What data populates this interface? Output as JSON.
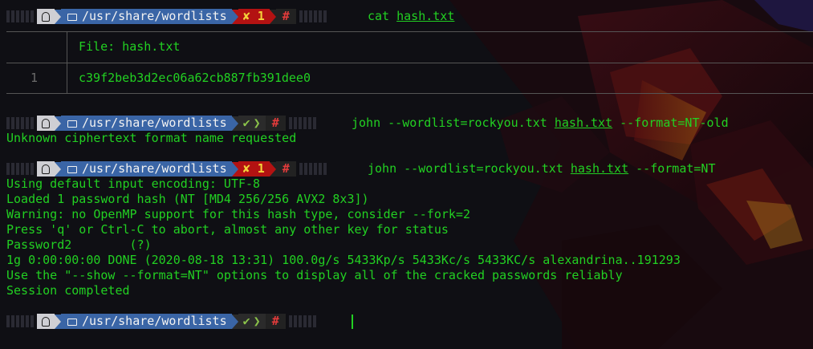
{
  "prompt": {
    "path": "/usr/share/wordlists",
    "error_mark": "✘",
    "error_code": "1",
    "ok_mark": "✔",
    "root_mark": "#"
  },
  "block1": {
    "command": "cat",
    "arg": "hash.txt"
  },
  "bat": {
    "file_label": "File: hash.txt",
    "line_number": "1",
    "line_content": "c39f2beb3d2ec06a62cb887fb391dee0"
  },
  "block2": {
    "command_pre": "john --wordlist=rockyou.txt ",
    "arg": "hash.txt",
    "command_post": " --format=NT-old",
    "output": [
      "Unknown ciphertext format name requested"
    ]
  },
  "block3": {
    "command_pre": "john --wordlist=rockyou.txt ",
    "arg": "hash.txt",
    "command_post": " --format=NT",
    "output": [
      "Using default input encoding: UTF-8",
      "Loaded 1 password hash (NT [MD4 256/256 AVX2 8x3])",
      "Warning: no OpenMP support for this hash type, consider --fork=2",
      "Press 'q' or Ctrl-C to abort, almost any other key for status",
      "Password2        (?)",
      "1g 0:00:00:00 DONE (2020-08-18 13:31) 100.0g/s 5433Kp/s 5433Kc/s 5433KC/s alexandrina..191293",
      "Use the \"--show --format=NT\" options to display all of the cracked passwords reliably",
      "Session completed"
    ]
  },
  "colors": {
    "background": "#0f0f14",
    "text": "#22d022",
    "path_segment": "#3a65a6",
    "error_segment": "#b31212",
    "os_segment": "#cfcfd4"
  }
}
